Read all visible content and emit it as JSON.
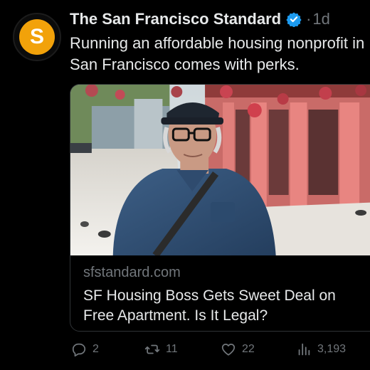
{
  "tweet": {
    "author": "The San Francisco Standard",
    "avatar_letter": "S",
    "separator": "·",
    "time": "1d",
    "text_line1": "Running an affordable housing nonprofit in",
    "text_line2": "San Francisco comes with perks."
  },
  "card": {
    "domain": "sfstandard.com",
    "title_line1": "SF Housing Boss Gets Sweet Deal on",
    "title_line2": "Free Apartment. Is It Legal?"
  },
  "actions": {
    "replies": "2",
    "reposts": "11",
    "likes": "22",
    "views": "3,193"
  },
  "colors": {
    "background": "#000000",
    "verified": "#1d9bf0",
    "avatar": "#f2a20a",
    "muted": "#71767b"
  },
  "icons": [
    "verified-badge-icon",
    "reply-icon",
    "repost-icon",
    "like-icon",
    "views-icon"
  ]
}
